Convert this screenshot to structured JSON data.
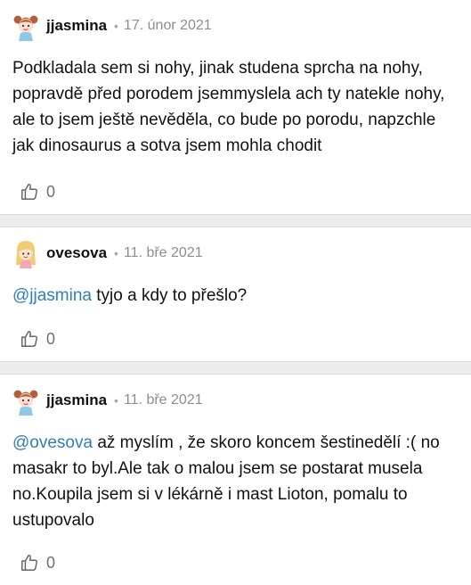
{
  "comments": [
    {
      "author": "jjasmina",
      "separator": "•",
      "date": "17. únor 2021",
      "mention": "",
      "text": "Podkladala sem si nohy, jinak studena sprcha na nohy, popravdě před porodem jsemmyslela ach ty natekle nohy, ale to jsem ještě nevěděla, co bude po porodu, napzchle jak dinosaurus a sotva jsem mohla chodit",
      "likes": "0",
      "avatar_icon": "girl-avatar-icon"
    },
    {
      "author": "ovesova",
      "separator": "•",
      "date": "11. bře 2021",
      "mention": "@jjasmina",
      "text": " tyjo a kdy to přešlo?",
      "likes": "0",
      "avatar_icon": "blonde-avatar-icon"
    },
    {
      "author": "jjasmina",
      "separator": "•",
      "date": "11. bře 2021",
      "mention": "@ovesova",
      "text": " až myslím , že skoro koncem šestinedělí :( no masakr to byl.Ale tak o malou jsem se postarat musela no.Koupila jsem si v lékárně i mast Lioton, pomalu to ustupovalo",
      "likes": "0",
      "avatar_icon": "girl-avatar-icon"
    }
  ],
  "colors": {
    "mention": "#2f7fb8",
    "divider": "#ececec",
    "meta": "#8d8d8d"
  }
}
